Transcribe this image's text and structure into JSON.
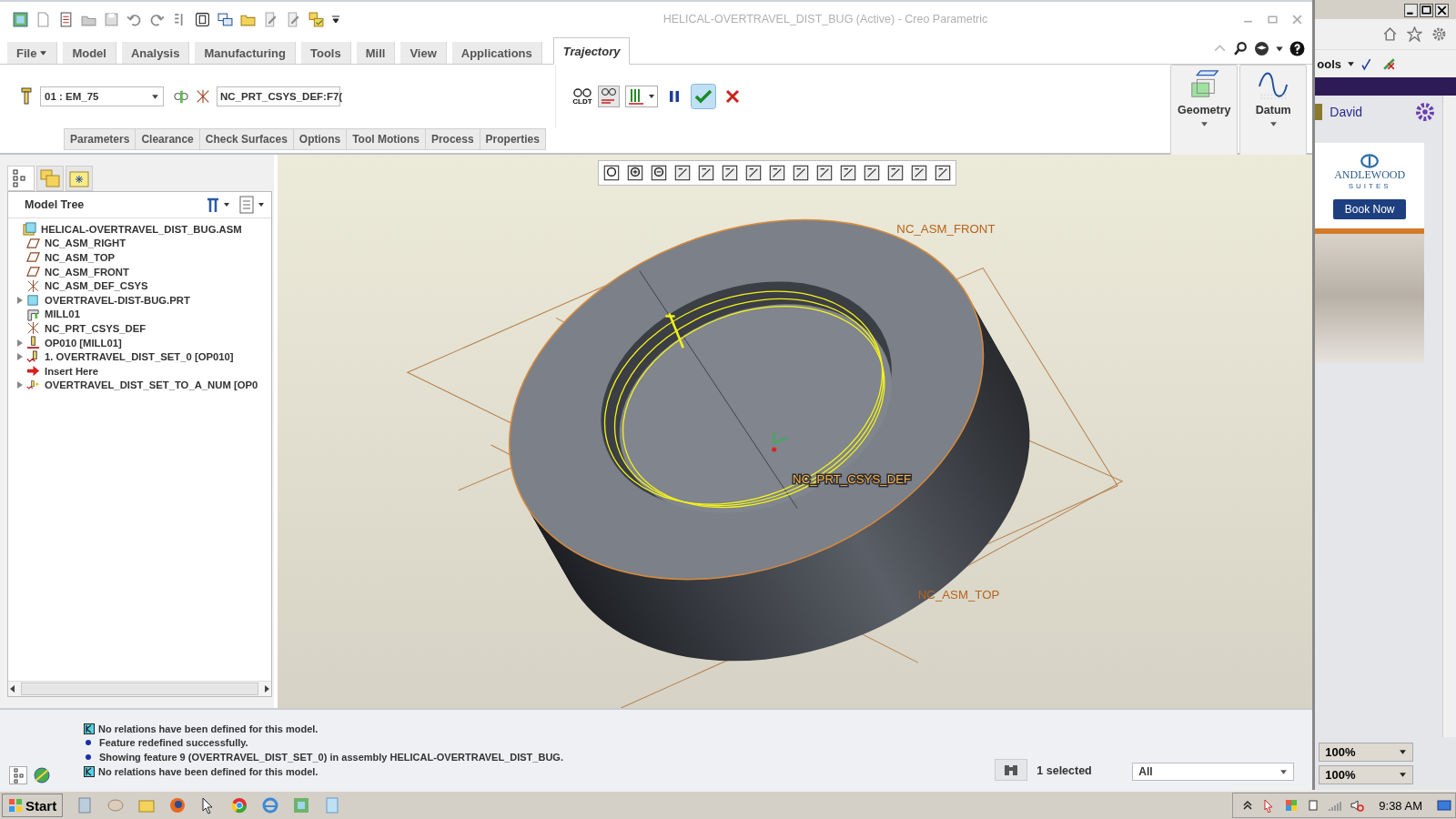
{
  "window": {
    "title": "HELICAL-OVERTRAVEL_DIST_BUG (Active) - Creo Parametric"
  },
  "tabs": [
    {
      "label": "File",
      "selected": false,
      "menu": true
    },
    {
      "label": "Model",
      "selected": false,
      "menu": false
    },
    {
      "label": "Analysis",
      "selected": false,
      "menu": false
    },
    {
      "label": "Manufacturing",
      "selected": false,
      "menu": false
    },
    {
      "label": "Tools",
      "selected": false,
      "menu": false
    },
    {
      "label": "Mill",
      "selected": false,
      "menu": false
    },
    {
      "label": "View",
      "selected": false,
      "menu": false
    },
    {
      "label": "Applications",
      "selected": false,
      "menu": false
    },
    {
      "label": "Trajectory",
      "selected": true,
      "menu": false
    }
  ],
  "trajectory": {
    "tool": "01 : EM_75",
    "csys": "NC_PRT_CSYS_DEF:F7(",
    "cldt": "CLDT",
    "subtabs": [
      {
        "label": "Parameters",
        "selected": false
      },
      {
        "label": "Clearance",
        "selected": false
      },
      {
        "label": "Check Surfaces",
        "selected": false
      },
      {
        "label": "Options",
        "selected": false
      },
      {
        "label": "Tool Motions",
        "selected": false
      },
      {
        "label": "Process",
        "selected": false
      },
      {
        "label": "Properties",
        "selected": false
      }
    ]
  },
  "ribbon_groups": [
    {
      "label": "Geometry",
      "kind": "geometry"
    },
    {
      "label": "Datum",
      "kind": "datum"
    }
  ],
  "model_tree": {
    "title": "Model Tree",
    "items": [
      {
        "label": "HELICAL-OVERTRAVEL_DIST_BUG.ASM",
        "kind": "assembly",
        "expandable": false,
        "children": [
          {
            "label": "NC_ASM_RIGHT",
            "kind": "plane",
            "expandable": false
          },
          {
            "label": "NC_ASM_TOP",
            "kind": "plane",
            "expandable": false
          },
          {
            "label": "NC_ASM_FRONT",
            "kind": "plane",
            "expandable": false
          },
          {
            "label": "NC_ASM_DEF_CSYS",
            "kind": "csys",
            "expandable": false
          },
          {
            "label": "OVERTRAVEL-DIST-BUG.PRT",
            "kind": "part",
            "expandable": true
          },
          {
            "label": "MILL01",
            "kind": "workcell",
            "expandable": false
          },
          {
            "label": "NC_PRT_CSYS_DEF",
            "kind": "csys",
            "expandable": false
          },
          {
            "label": "OP010 [MILL01]",
            "kind": "operation",
            "expandable": true
          },
          {
            "label": "1. OVERTRAVEL_DIST_SET_0 [OP010]",
            "kind": "sequence",
            "expandable": true
          },
          {
            "label": "Insert Here",
            "kind": "insert",
            "expandable": false
          },
          {
            "label": "OVERTRAVEL_DIST_SET_TO_A_NUM [OP0",
            "kind": "sequence-new",
            "expandable": true
          }
        ]
      }
    ]
  },
  "viewport": {
    "labels": [
      {
        "text": "NC_ASM_FRONT",
        "kind": "front"
      },
      {
        "text": "NC_PRT_CSYS_DEF",
        "kind": "csys"
      },
      {
        "text": "NC_ASM_TOP",
        "kind": "top"
      }
    ]
  },
  "messages": [
    {
      "kind": "relations",
      "text": "No relations have been defined for this model."
    },
    {
      "kind": "bullet",
      "text": "Feature redefined successfully."
    },
    {
      "kind": "bullet",
      "text": "Showing feature 9 (OVERTRAVEL_DIST_SET_0) in assembly HELICAL-OVERTRAVEL_DIST_BUG."
    },
    {
      "kind": "relations",
      "text": "No relations have been defined for this model."
    }
  ],
  "status": {
    "selection": "1 selected",
    "filter": "All"
  },
  "browser": {
    "menu": "ools",
    "user": "David",
    "ad_brand": "ANDLEWOOD",
    "ad_sub": "SUITES",
    "ad_button": "Book Now",
    "zoom": "100%",
    "zoom_lower": "100%"
  },
  "taskbar": {
    "start": "Start",
    "time": "9:38 AM"
  }
}
